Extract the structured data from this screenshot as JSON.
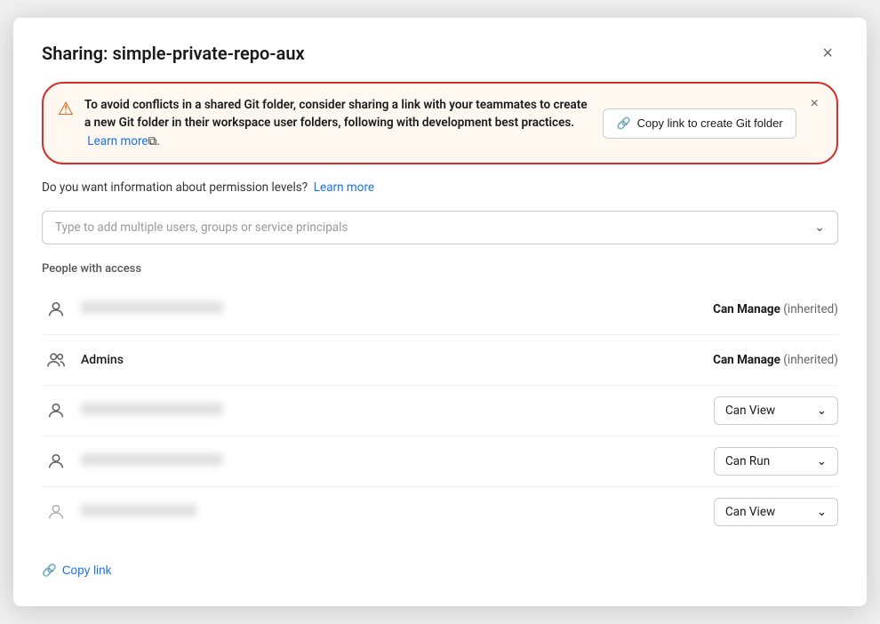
{
  "modal": {
    "title": "Sharing: simple-private-repo-aux",
    "close_label": "×"
  },
  "warning_banner": {
    "icon": "⚠",
    "text_bold": "To avoid conflicts in a shared Git folder, consider sharing a link with your teammates to create a new Git folder in their workspace user folders, following with development best practices.",
    "learn_more_label": "Learn more",
    "external_icon": "⧉",
    "dismiss_label": "×",
    "copy_git_btn_icon": "🔗",
    "copy_git_btn_label": "Copy link to create Git folder"
  },
  "permission_info": {
    "text": "Do you want information about permission levels?",
    "learn_more_label": "Learn more"
  },
  "add_users": {
    "placeholder": "Type to add multiple users, groups or service principals",
    "chevron": "⌄"
  },
  "people_section": {
    "label": "People with access",
    "people": [
      {
        "id": "user1",
        "name_blurred": true,
        "name": "",
        "icon_type": "person",
        "permission": "Can Manage",
        "permission_suffix": "(inherited)",
        "has_dropdown": false
      },
      {
        "id": "admins",
        "name_blurred": false,
        "name": "Admins",
        "icon_type": "group",
        "permission": "Can Manage",
        "permission_suffix": "(inherited)",
        "has_dropdown": false
      },
      {
        "id": "user2",
        "name_blurred": true,
        "name": "",
        "icon_type": "person",
        "permission": "Can View",
        "permission_suffix": "",
        "has_dropdown": true
      },
      {
        "id": "user3",
        "name_blurred": true,
        "name": "",
        "icon_type": "person",
        "permission": "Can Run",
        "permission_suffix": "",
        "has_dropdown": true
      },
      {
        "id": "user4",
        "name_blurred": true,
        "name": "",
        "icon_type": "person-thin",
        "permission": "Can View",
        "permission_suffix": "",
        "has_dropdown": true
      }
    ]
  },
  "footer": {
    "copy_link_icon": "🔗",
    "copy_link_label": "Copy link"
  }
}
